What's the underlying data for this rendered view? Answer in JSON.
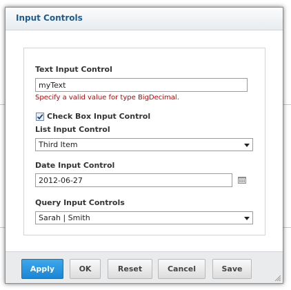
{
  "dialog": {
    "title": "Input Controls"
  },
  "form": {
    "text_control": {
      "label": "Text Input Control",
      "value": "myText",
      "error": "Specify a valid value for type BigDecimal."
    },
    "checkbox_control": {
      "label": "Check Box Input Control",
      "checked": true
    },
    "list_control": {
      "label": "List Input Control",
      "selected": "Third Item"
    },
    "date_control": {
      "label": "Date Input Control",
      "value": "2012-06-27",
      "icon": "calendar-icon"
    },
    "query_control": {
      "label": "Query Input Controls",
      "selected": "Sarah | Smith"
    }
  },
  "buttons": {
    "apply": "Apply",
    "ok": "OK",
    "reset": "Reset",
    "cancel": "Cancel",
    "save": "Save"
  },
  "colors": {
    "title": "#1a5d92",
    "error": "#c00000",
    "primary_button": "#2a96e0"
  }
}
